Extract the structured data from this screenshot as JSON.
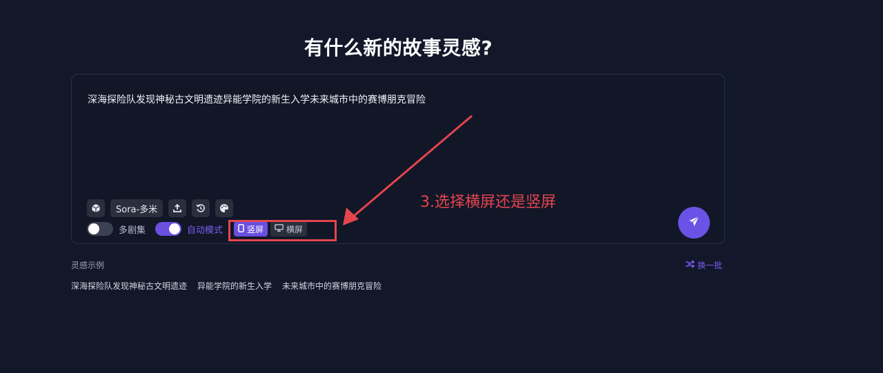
{
  "heading": "有什么新的故事灵感?",
  "prompt": {
    "value": "深海探险队发现神秘古文明遗迹异能学院的新生入学未来城市中的赛博朋克冒险"
  },
  "toolbar": {
    "model_label": "Sora-多米",
    "icons": [
      "cube-icon",
      "upload-icon",
      "history-icon",
      "palette-icon"
    ]
  },
  "toggles": {
    "multi_episode_label": "多剧集",
    "multi_episode_on": false,
    "auto_mode_label": "自动模式",
    "auto_mode_on": true
  },
  "orientation": {
    "portrait_label": "竖屏",
    "landscape_label": "横屏",
    "selected": "portrait"
  },
  "annotation": {
    "text": "3.选择横屏还是竖屏",
    "color": "#e5454d"
  },
  "examples": {
    "label": "灵感示例",
    "shuffle_label": "换一批",
    "items": [
      "深海探险队发现神秘古文明遗迹",
      "异能学院的新生入学",
      "未来城市中的赛博朋克冒险"
    ]
  },
  "colors": {
    "background": "#12172a",
    "accent": "#6a4fe0",
    "annotation": "#e5454d"
  }
}
